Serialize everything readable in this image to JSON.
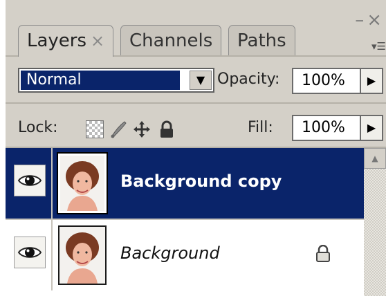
{
  "tabs": [
    {
      "label": "Layers",
      "close": "×"
    },
    {
      "label": "Channels"
    },
    {
      "label": "Paths"
    }
  ],
  "window_controls": {
    "minimize": "–",
    "close": "×"
  },
  "panel_menu_icon": "panel-menu-icon",
  "blend_mode": {
    "value": "Normal"
  },
  "opacity": {
    "label": "Opacity:",
    "value": "100%"
  },
  "lock": {
    "label": "Lock:",
    "icons": [
      "lock-transparent-pixels-icon",
      "lock-image-pixels-icon",
      "lock-position-icon",
      "lock-all-icon"
    ]
  },
  "fill": {
    "label": "Fill:",
    "value": "100%"
  },
  "layers": [
    {
      "name": "Background copy",
      "visible": true,
      "selected": true,
      "locked": false
    },
    {
      "name": "Background",
      "visible": true,
      "selected": false,
      "locked": true
    }
  ],
  "colors": {
    "selection": "#0a246a",
    "panel": "#d4d0c8"
  }
}
